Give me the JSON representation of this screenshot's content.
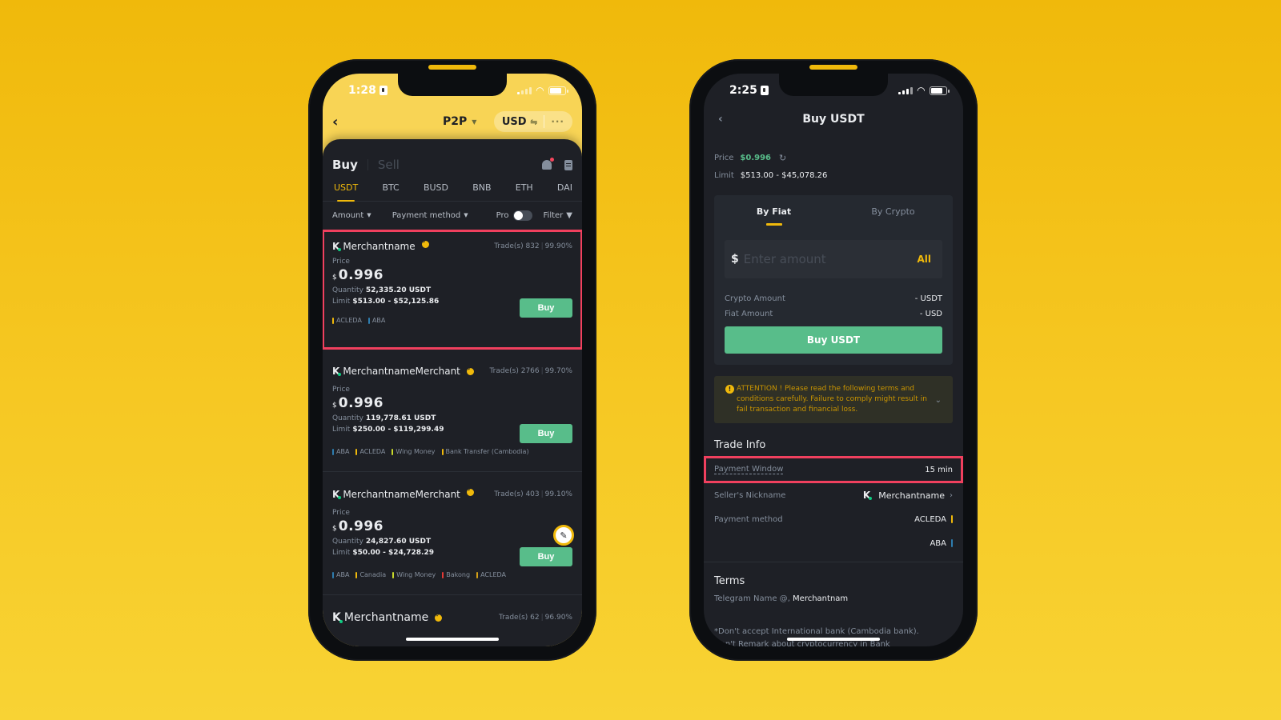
{
  "colors": {
    "brand_yellow": "#F0B90B",
    "buy_green": "#58BD8A",
    "highlight_red": "#F0405E",
    "dark_bg": "#1E2026"
  },
  "left_phone": {
    "status": {
      "time": "1:28"
    },
    "header": {
      "title": "P2P",
      "currency": "USD",
      "swap_icon": "⇋",
      "more_icon": "···",
      "back_icon": "‹"
    },
    "tabs": {
      "buy": "Buy",
      "sell": "Sell"
    },
    "coins": [
      "USDT",
      "BTC",
      "BUSD",
      "BNB",
      "ETH",
      "DAI"
    ],
    "active_coin": "USDT",
    "filters": {
      "amount": "Amount",
      "payment_method": "Payment method",
      "pro": "Pro",
      "filter": "Filter"
    },
    "ads": [
      {
        "initial": "K",
        "name": "Merchantname",
        "trades": "Trade(s) 832",
        "completion": "99.90%",
        "price_label": "Price",
        "currency": "$",
        "price": "0.996",
        "quantity_label": "Quantity",
        "quantity": "52,335.20 USDT",
        "limit_label": "Limit",
        "limit": "$513.00 - $52,125.86",
        "buy_label": "Buy",
        "methods": [
          {
            "name": "ACLEDA",
            "color": "#F0B90B"
          },
          {
            "name": "ABA",
            "color": "#2E7DAF"
          }
        ],
        "highlighted": true
      },
      {
        "initial": "K",
        "name": "MerchantnameMerchant",
        "trades": "Trade(s) 2766",
        "completion": "99.70%",
        "price_label": "Price",
        "currency": "$",
        "price": "0.996",
        "quantity_label": "Quantity",
        "quantity": "119,778.61 USDT",
        "limit_label": "Limit",
        "limit": "$250.00 - $119,299.49",
        "buy_label": "Buy",
        "methods": [
          {
            "name": "ABA",
            "color": "#2E7DAF"
          },
          {
            "name": "ACLEDA",
            "color": "#F0B90B"
          },
          {
            "name": "Wing Money",
            "color": "#C8D92B"
          },
          {
            "name": "Bank Transfer (Cambodia)",
            "color": "#F0B90B"
          }
        ]
      },
      {
        "initial": "K",
        "name": "MerchantnameMerchant",
        "trades": "Trade(s) 403",
        "completion": "99.10%",
        "price_label": "Price",
        "currency": "$",
        "price": "0.996",
        "quantity_label": "Quantity",
        "quantity": "24,827.60 USDT",
        "limit_label": "Limit",
        "limit": "$50.00 - $24,728.29",
        "buy_label": "Buy",
        "methods": [
          {
            "name": "ABA",
            "color": "#2E7DAF"
          },
          {
            "name": "Canadia",
            "color": "#F0B90B"
          },
          {
            "name": "Wing Money",
            "color": "#C8D92B"
          },
          {
            "name": "Bakong",
            "color": "#E53935"
          },
          {
            "name": "ACLEDA",
            "color": "#D4A017"
          }
        ]
      },
      {
        "initial": "K",
        "name": "Merchantname",
        "trades": "Trade(s) 62",
        "completion": "96.90%"
      }
    ]
  },
  "right_phone": {
    "status": {
      "time": "2:25"
    },
    "header": {
      "title": "Buy USDT",
      "back_icon": "‹"
    },
    "price_label": "Price",
    "price": "$0.996",
    "limit_label": "Limit",
    "limit": "$513.00 - $45,078.26",
    "tabs": [
      "By Fiat",
      "By Crypto"
    ],
    "active_tab": "By Fiat",
    "amount": {
      "currency": "$",
      "placeholder": "Enter amount",
      "value": "",
      "all_label": "All"
    },
    "crypto_amount": {
      "label": "Crypto Amount",
      "value": "- USDT"
    },
    "fiat_amount": {
      "label": "Fiat Amount",
      "value": "- USD"
    },
    "buy_button": "Buy USDT",
    "attention": "ATTENTION ! Please read the following terms and conditions carefully. Failure to comply might result in fail transaction and financial loss.",
    "trade_info": {
      "title": "Trade Info",
      "payment_window": {
        "label": "Payment Window",
        "value": "15 min"
      },
      "seller": {
        "label": "Seller's Nickname",
        "initial": "K",
        "value": "Merchantname"
      },
      "payment_method": {
        "label": "Payment method",
        "values": [
          {
            "name": "ACLEDA",
            "color": "#F0B90B"
          },
          {
            "name": "ABA",
            "color": "#2E7DAF"
          }
        ]
      }
    },
    "terms": {
      "title": "Terms",
      "telegram_prefix": "Telegram Name @",
      "telegram_name": "Merchantnam",
      "note": "*Don't accept International bank (Cambodia bank).",
      "note2": "Don't Remark about cryptocurrency in Bank"
    }
  }
}
